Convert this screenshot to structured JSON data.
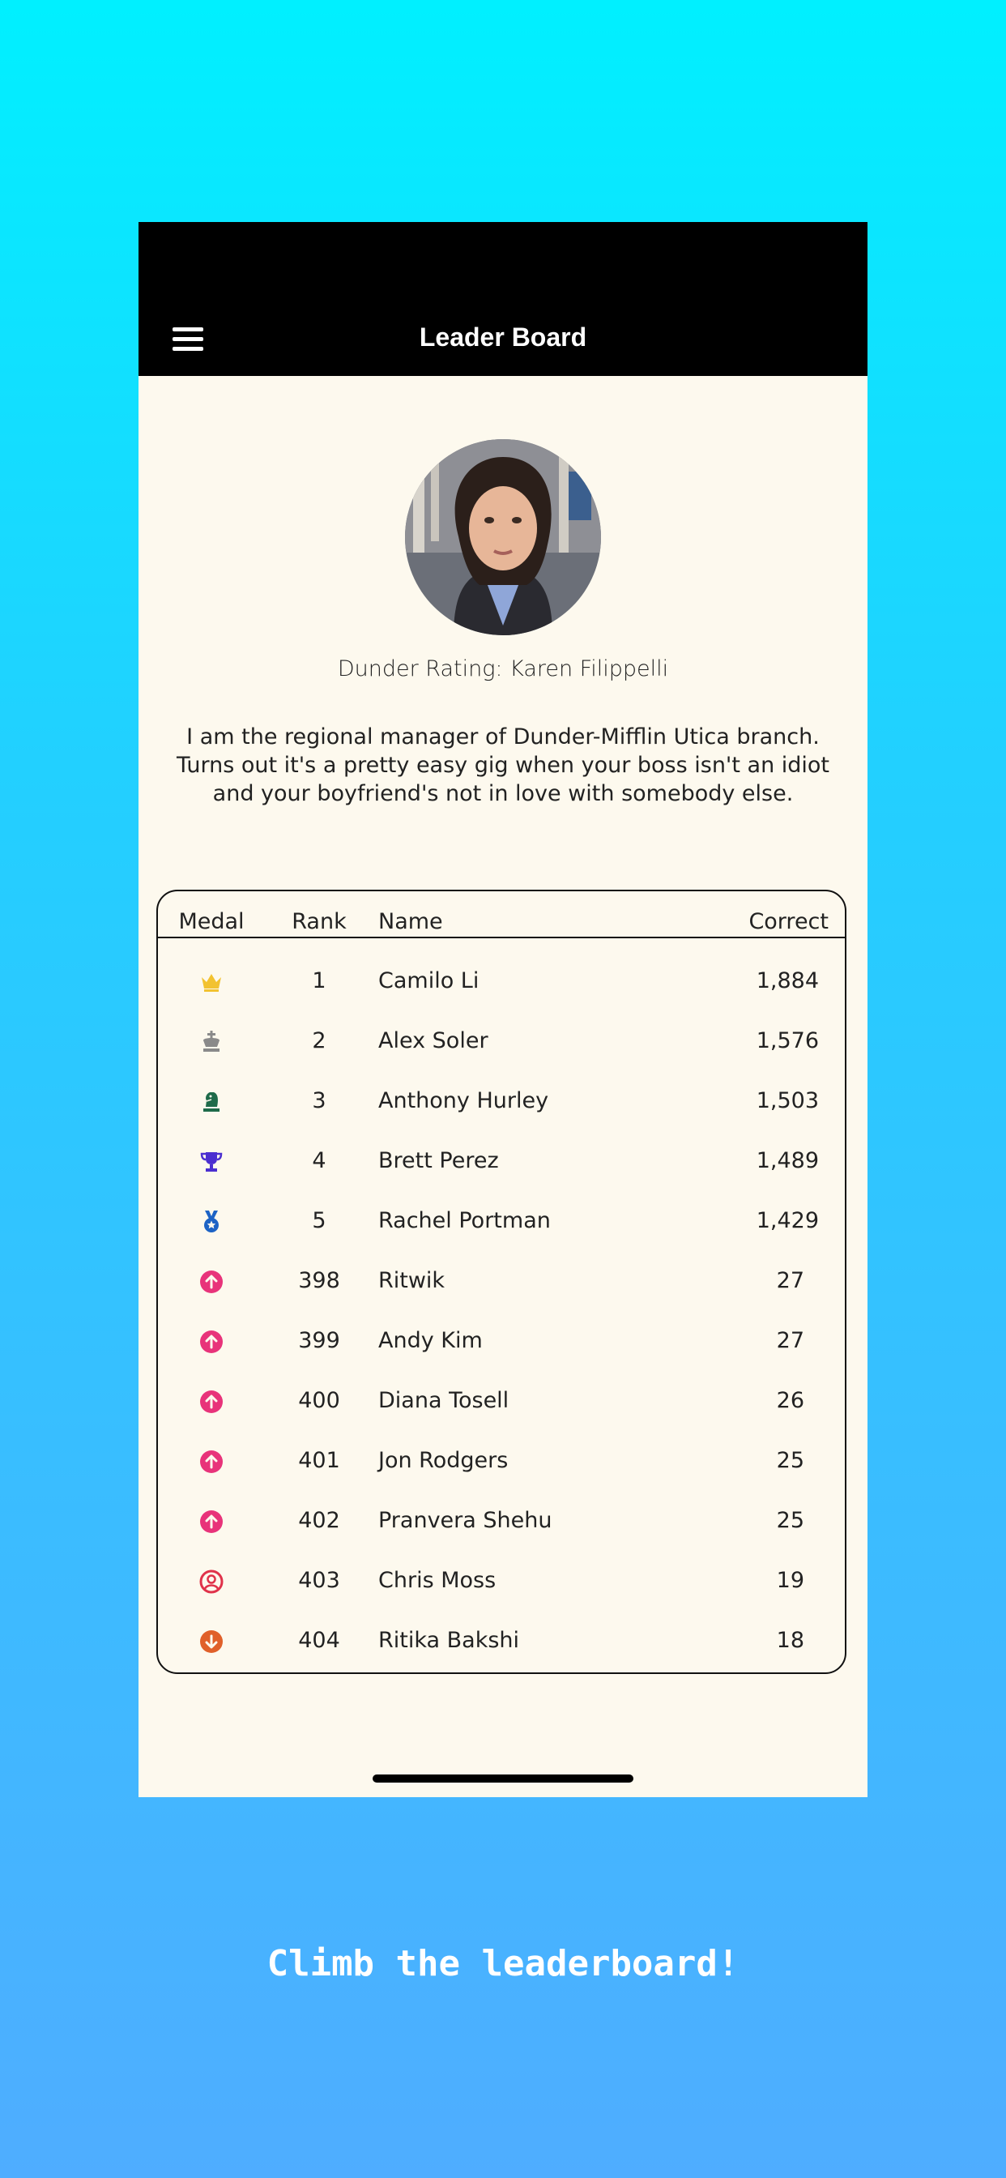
{
  "header": {
    "title": "Leader Board"
  },
  "profile": {
    "rating_line": "Dunder Rating: Karen Filippelli",
    "bio": "I am the regional manager of Dunder-Mifflin Utica branch. Turns out it's a pretty easy gig when your boss isn't an idiot and your boyfriend's not in love with somebody else."
  },
  "table": {
    "columns": {
      "medal": "Medal",
      "rank": "Rank",
      "name": "Name",
      "correct": "Correct"
    },
    "rows": [
      {
        "rank": "1",
        "name": "Camilo Li",
        "correct": "1,884",
        "icon": "crown-icon",
        "color": "#f2c230"
      },
      {
        "rank": "2",
        "name": "Alex Soler",
        "correct": "1,576",
        "icon": "chess-king-icon",
        "color": "#8a8a8a"
      },
      {
        "rank": "3",
        "name": "Anthony Hurley",
        "correct": "1,503",
        "icon": "chess-knight-icon",
        "color": "#1f6b4a"
      },
      {
        "rank": "4",
        "name": "Brett Perez",
        "correct": "1,489",
        "icon": "trophy-icon",
        "color": "#4b2fd0"
      },
      {
        "rank": "5",
        "name": "Rachel Portman",
        "correct": "1,429",
        "icon": "medal-icon",
        "color": "#1d63c5"
      },
      {
        "rank": "398",
        "name": "Ritwik",
        "correct": "27",
        "icon": "arrow-up-circle-icon",
        "color": "#e8337a"
      },
      {
        "rank": "399",
        "name": "Andy Kim",
        "correct": "27",
        "icon": "arrow-up-circle-icon",
        "color": "#e8337a"
      },
      {
        "rank": "400",
        "name": "Diana Tosell",
        "correct": "26",
        "icon": "arrow-up-circle-icon",
        "color": "#e8337a"
      },
      {
        "rank": "401",
        "name": "Jon Rodgers",
        "correct": "25",
        "icon": "arrow-up-circle-icon",
        "color": "#e8337a"
      },
      {
        "rank": "402",
        "name": "Pranvera Shehu",
        "correct": "25",
        "icon": "arrow-up-circle-icon",
        "color": "#e8337a"
      },
      {
        "rank": "403",
        "name": "Chris Moss",
        "correct": "19",
        "icon": "user-circle-icon",
        "color": "#e0324a"
      },
      {
        "rank": "404",
        "name": "Ritika Bakshi",
        "correct": "18",
        "icon": "arrow-down-circle-icon",
        "color": "#e0602a"
      }
    ]
  },
  "promo": {
    "text": "Climb the leaderboard!"
  },
  "colors": {
    "background_top": "#00f0ff",
    "background_bottom": "#4fadff",
    "app_background": "#fdf9ee",
    "header_background": "#000000"
  }
}
